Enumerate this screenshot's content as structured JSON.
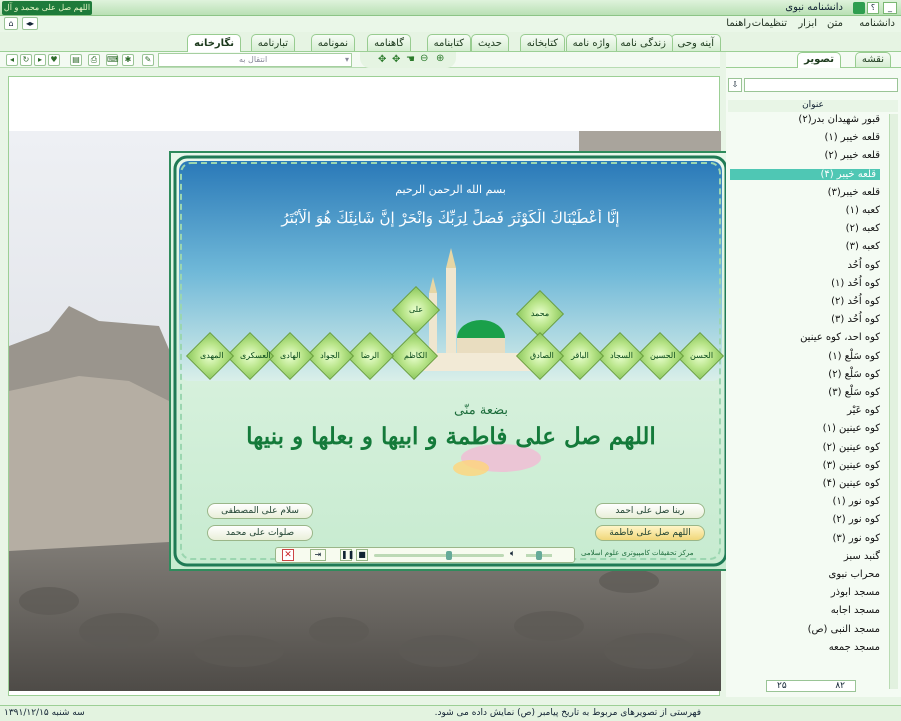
{
  "window": {
    "title": "دانشنامه نبوی",
    "help_label": "؟",
    "calligraphy": "اللهم صل علی محمد و آل محمد"
  },
  "menu": {
    "items": [
      "دانشنامه",
      "متن",
      "ابزار",
      "تنظیمات",
      "راهنما"
    ]
  },
  "tabs": [
    "آینه وحی",
    "زندگی نامه",
    "واژه نامه",
    "کتابخانه",
    "حدیث",
    "کتابنامه",
    "گاهنامه",
    "نمونامه",
    "تبارنامه",
    "نگارخانه"
  ],
  "toolbar": {
    "transfer_placeholder": "انتقال به"
  },
  "panel_tabs": {
    "left": "نقشه",
    "right": "تصویر"
  },
  "list": {
    "header": "عنوان",
    "items": [
      "قبور شهیدان بدر(۲)",
      "قلعه خیبر (۱)",
      "قلعه خیبر (۲)",
      "قلعه خیبر (۴)",
      "قلعه خیبر(۳)",
      "کعبه (۱)",
      "کعبه (۲)",
      "کعبه (۳)",
      "کوه اُحُد",
      "کوه اُحُد (۱)",
      "کوه اُحُد (۲)",
      "کوه اُحُد (۳)",
      "کوه احد، کوه عینین",
      "کوه سَلْع (۱)",
      "کوه سَلْع (۲)",
      "کوه سَلْع (۳)",
      "کوه عَیْر",
      "کوه عینین (۱)",
      "کوه عینین (۲)",
      "کوه عینین (۳)",
      "کوه عینین (۴)",
      "کوه نور (۱)",
      "کوه نور (۲)",
      "کوه نور (۳)",
      "گنبد سبز",
      "محراب نبوی",
      "مسجد ابوذر",
      "مسجد اجابه",
      "مسجد النبی (ص)",
      "مسجد جمعه"
    ],
    "selected_index": 3
  },
  "pager": {
    "current": "۲۵",
    "total": "۸۲"
  },
  "overlay": {
    "basmala": "بسم الله الرحمن الرحیم",
    "verse": "إِنَّا أَعْطَيْنَاكَ الْكَوْثَرَ فَصَلِّ لِرَبِّكَ وَانْحَرْ إِنَّ شَانِئَكَ هُوَ الْأَبْتَرُ",
    "main_calligraphy": "اللهم صل علی فاطمة و ابیها و بعلها و بنیها",
    "sub_calligraphy": "بضعة منّی",
    "medal_top_left": "علی",
    "medal_top_right": "محمد",
    "medals": [
      "الحسن",
      "الحسین",
      "السجاد",
      "الباقر",
      "الصادق",
      "الکاظم",
      "الرضا",
      "الجواد",
      "الهادی",
      "العسکری",
      "المهدی"
    ],
    "buttons": {
      "b1": "سلام علی المصطفی",
      "b2": "صلوات علی محمد",
      "b3": "ربنا صل علی احمد",
      "b4": "اللهم صل علی فاطمة"
    },
    "credit": "مرکز تحقیقات کامپیوتری علوم اسلامی"
  },
  "status": {
    "date": "سه شنبه ۱۳۹۱/۱۲/۱۵",
    "message": "فهرستی از تصویرهای مربوط به تاریخ پیامبر (ص) نمایش داده می شود."
  },
  "colors": {
    "accent": "#4fc7b4",
    "frame": "#2f8b5c",
    "teal_sky": "#3a8fbf"
  }
}
